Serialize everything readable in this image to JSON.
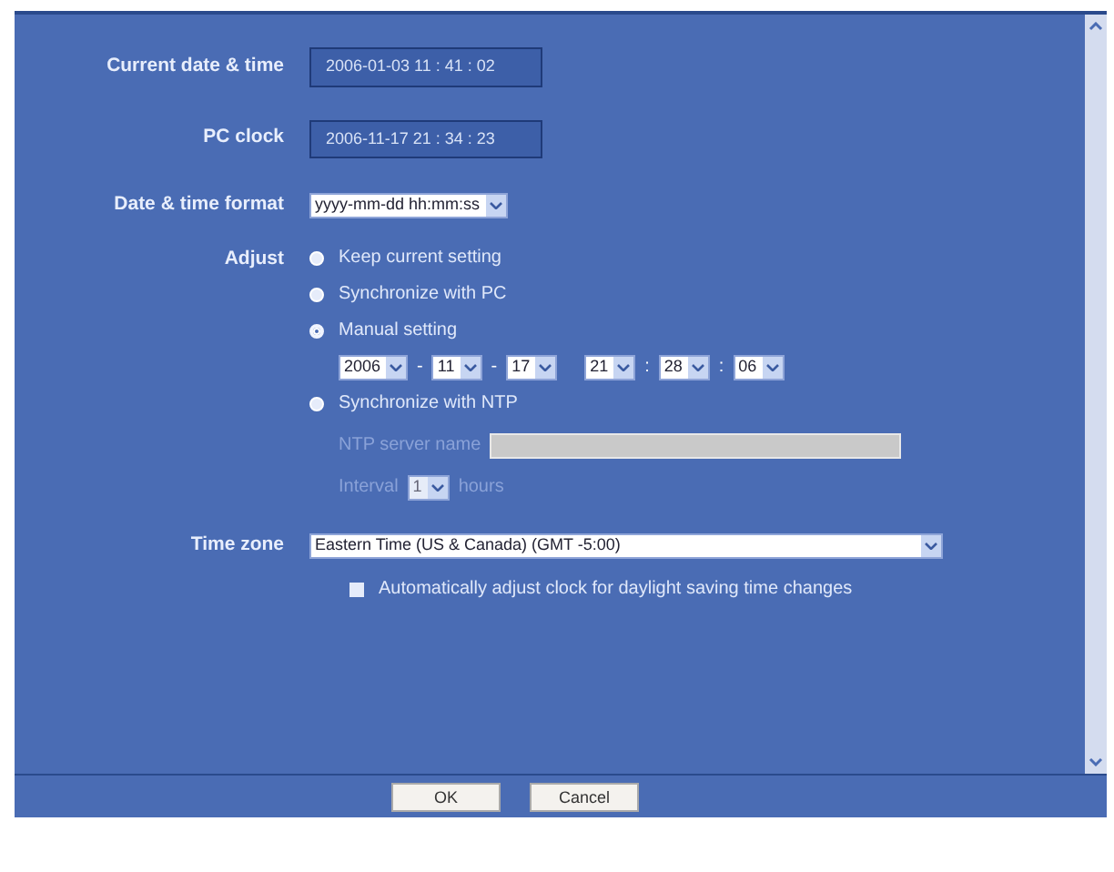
{
  "fields": [
    {
      "label": "Current date & time",
      "kind": "readout",
      "value": "2006-01-03 11 : 41 : 02"
    },
    {
      "label": "PC clock",
      "kind": "readout",
      "value": "2006-11-17 21 : 34 : 23"
    },
    {
      "label": "Date & time format",
      "kind": "select",
      "value": "yyyy-mm-dd hh:mm:ss"
    }
  ],
  "adjust": {
    "label": "Adjust",
    "options": [
      {
        "label": "Keep current setting",
        "selected": false
      },
      {
        "label": "Synchronize with PC",
        "selected": false
      },
      {
        "label": "Manual setting",
        "selected": true
      },
      {
        "label": "Synchronize with NTP",
        "selected": false
      }
    ],
    "manual": [
      {
        "value": "2006",
        "sep": "-"
      },
      {
        "value": "11",
        "sep": "-"
      },
      {
        "value": "17"
      },
      {
        "value": "21",
        "sep": ":"
      },
      {
        "value": "28",
        "sep": ":"
      },
      {
        "value": "06"
      }
    ],
    "ntp_server": {
      "label": "NTP server name",
      "disabled": true
    },
    "interval": {
      "label": "Interval",
      "value": "1",
      "unit": "hours",
      "disabled": true
    }
  },
  "time_zone": {
    "label": "Time zone",
    "value": "Eastern Time (US & Canada) (GMT -5:00)",
    "dst": {
      "label": "Automatically adjust clock for daylight saving time changes",
      "checked": false
    }
  },
  "buttons": [
    "OK",
    "Cancel"
  ]
}
